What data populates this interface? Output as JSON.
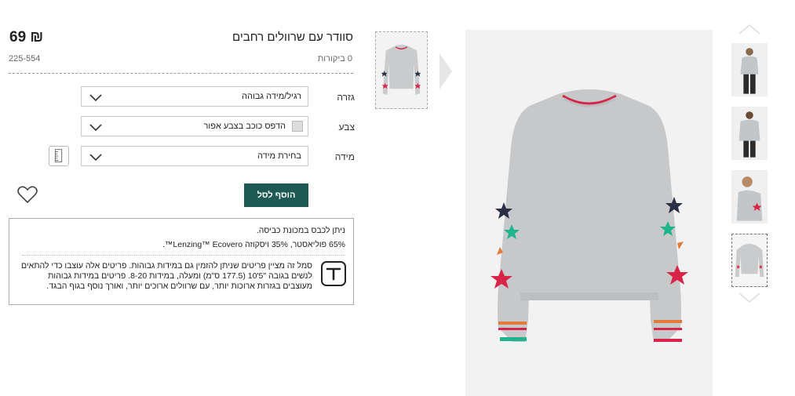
{
  "product": {
    "title": "סוודר עם שרוולים רחבים",
    "price": "69 ₪",
    "reviews": "0 ביקורות",
    "sku": "225-554"
  },
  "options": {
    "fit_label": "גזרה",
    "fit_value": "רגיל/מידה גבוהה",
    "color_label": "צבע",
    "color_value": "הדפס כוכב בצבע אפור",
    "size_label": "מידה",
    "size_value": "בחירת מידה"
  },
  "actions": {
    "add_to_bag": "הוסף לסל"
  },
  "info": {
    "wash": "ניתן לכבס במכונת כביסה.",
    "composition": "65% פוליאסטר, 35% ויסקוזה Lenzing™ Ecovero™.",
    "tall_line1": "סמל זה מציין פריטים שניתן להזמין גם במידות גבוהות. פריטים אלה עוצבו כדי להתאים",
    "tall_line2": "לנשים בגובה \"5'10 (177.5 ס\"מ) ומעלה, במידות 8-20. פריטים במידות גבוהות",
    "tall_line3": "מעוצבים בגזרות ארוכות יותר, עם שרוולים ארוכים יותר, ואורך נוסף בגוף הבגד."
  },
  "colors": {
    "accent": "#1d5a54",
    "sweater": "#c9cbcc",
    "star_red": "#d9244a",
    "star_green": "#1fb58a",
    "star_navy": "#2a2f45"
  },
  "icons": [
    "chevron-up-icon",
    "chevron-down-icon",
    "heart-icon",
    "size-guide-icon",
    "tall-icon"
  ]
}
